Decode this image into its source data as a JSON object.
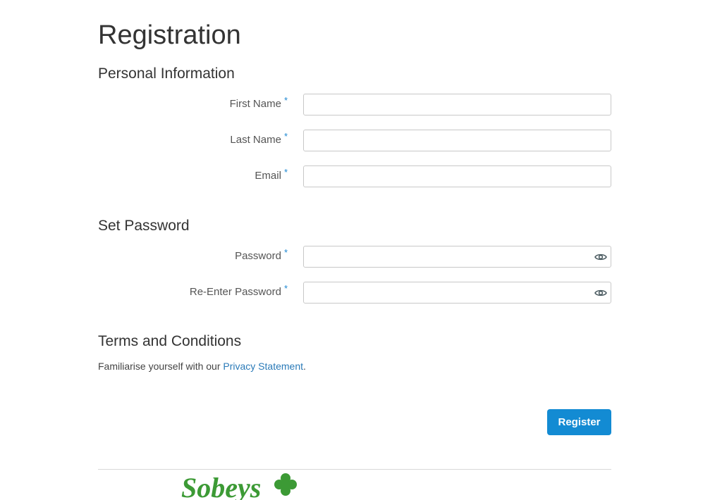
{
  "page": {
    "title": "Registration"
  },
  "personal": {
    "heading": "Personal Information",
    "first_name": {
      "label": "First Name",
      "required": "*",
      "value": ""
    },
    "last_name": {
      "label": "Last Name",
      "required": "*",
      "value": ""
    },
    "email": {
      "label": "Email",
      "required": "*",
      "value": ""
    }
  },
  "password": {
    "heading": "Set Password",
    "password": {
      "label": "Password",
      "required": "*",
      "value": "",
      "toggle_icon": "eye-icon"
    },
    "reenter": {
      "label": "Re-Enter Password",
      "required": "*",
      "value": "",
      "toggle_icon": "eye-icon"
    }
  },
  "terms": {
    "heading": "Terms and Conditions",
    "text": "Familiarise yourself with our ",
    "link": "Privacy Statement",
    "suffix": "."
  },
  "actions": {
    "register_label": "Register"
  },
  "footer": {
    "logo_text": "Sobeys",
    "logo_icon": "clover-icon"
  },
  "colors": {
    "accent": "#138bd3",
    "required": "#1e88d2",
    "link": "#2a7ab8",
    "logo": "#3c9a35"
  }
}
